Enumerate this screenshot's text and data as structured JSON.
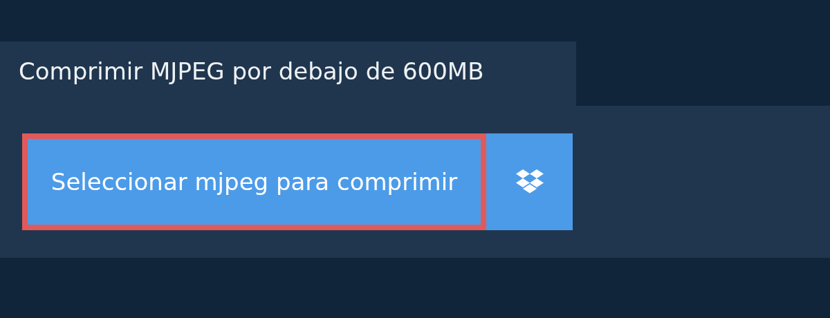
{
  "title": "Comprimir MJPEG por debajo de 600MB",
  "select_button": {
    "label": "Seleccionar mjpeg para comprimir",
    "focused": true
  }
}
